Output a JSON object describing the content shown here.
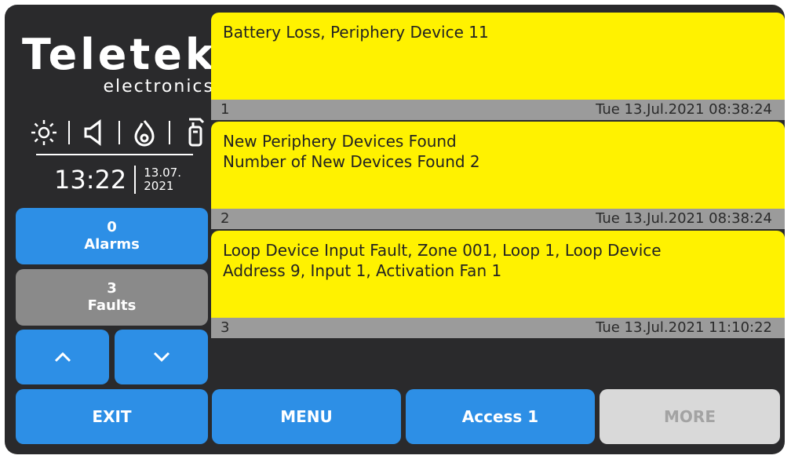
{
  "brand": {
    "name": "Teletek",
    "sub": "electronics"
  },
  "clock": {
    "time": "13:22",
    "date_top": "13.07.",
    "date_bottom": "2021"
  },
  "status_icons": [
    "sun-icon",
    "speaker-icon",
    "fire-icon",
    "extinguisher-icon"
  ],
  "counters": {
    "alarms": {
      "count": "0",
      "label": "Alarms"
    },
    "faults": {
      "count": "3",
      "label": "Faults"
    }
  },
  "nav": {
    "up": "^",
    "down": "v"
  },
  "messages": [
    {
      "text": "Battery Loss, Periphery Device 11",
      "index": "1",
      "timestamp": "Tue 13.Jul.2021 08:38:24"
    },
    {
      "text": "New Periphery Devices Found\nNumber of New Devices Found 2",
      "index": "2",
      "timestamp": "Tue 13.Jul.2021 08:38:24"
    },
    {
      "text": "Loop Device Input Fault, Zone 001, Loop 1, Loop Device\nAddress 9, Input 1, Activation Fan 1",
      "index": "3",
      "timestamp": "Tue 13.Jul.2021 11:10:22"
    }
  ],
  "bottom_bar": {
    "exit": "EXIT",
    "menu": "MENU",
    "access": "Access 1",
    "more": "MORE"
  },
  "colors": {
    "background": "#2a2a2c",
    "message": "#fff200",
    "message_footer": "#9b9b9b",
    "button_blue": "#2d8fe6",
    "button_gray": "#8a8a8a",
    "button_disabled": "#d9d9d9"
  }
}
